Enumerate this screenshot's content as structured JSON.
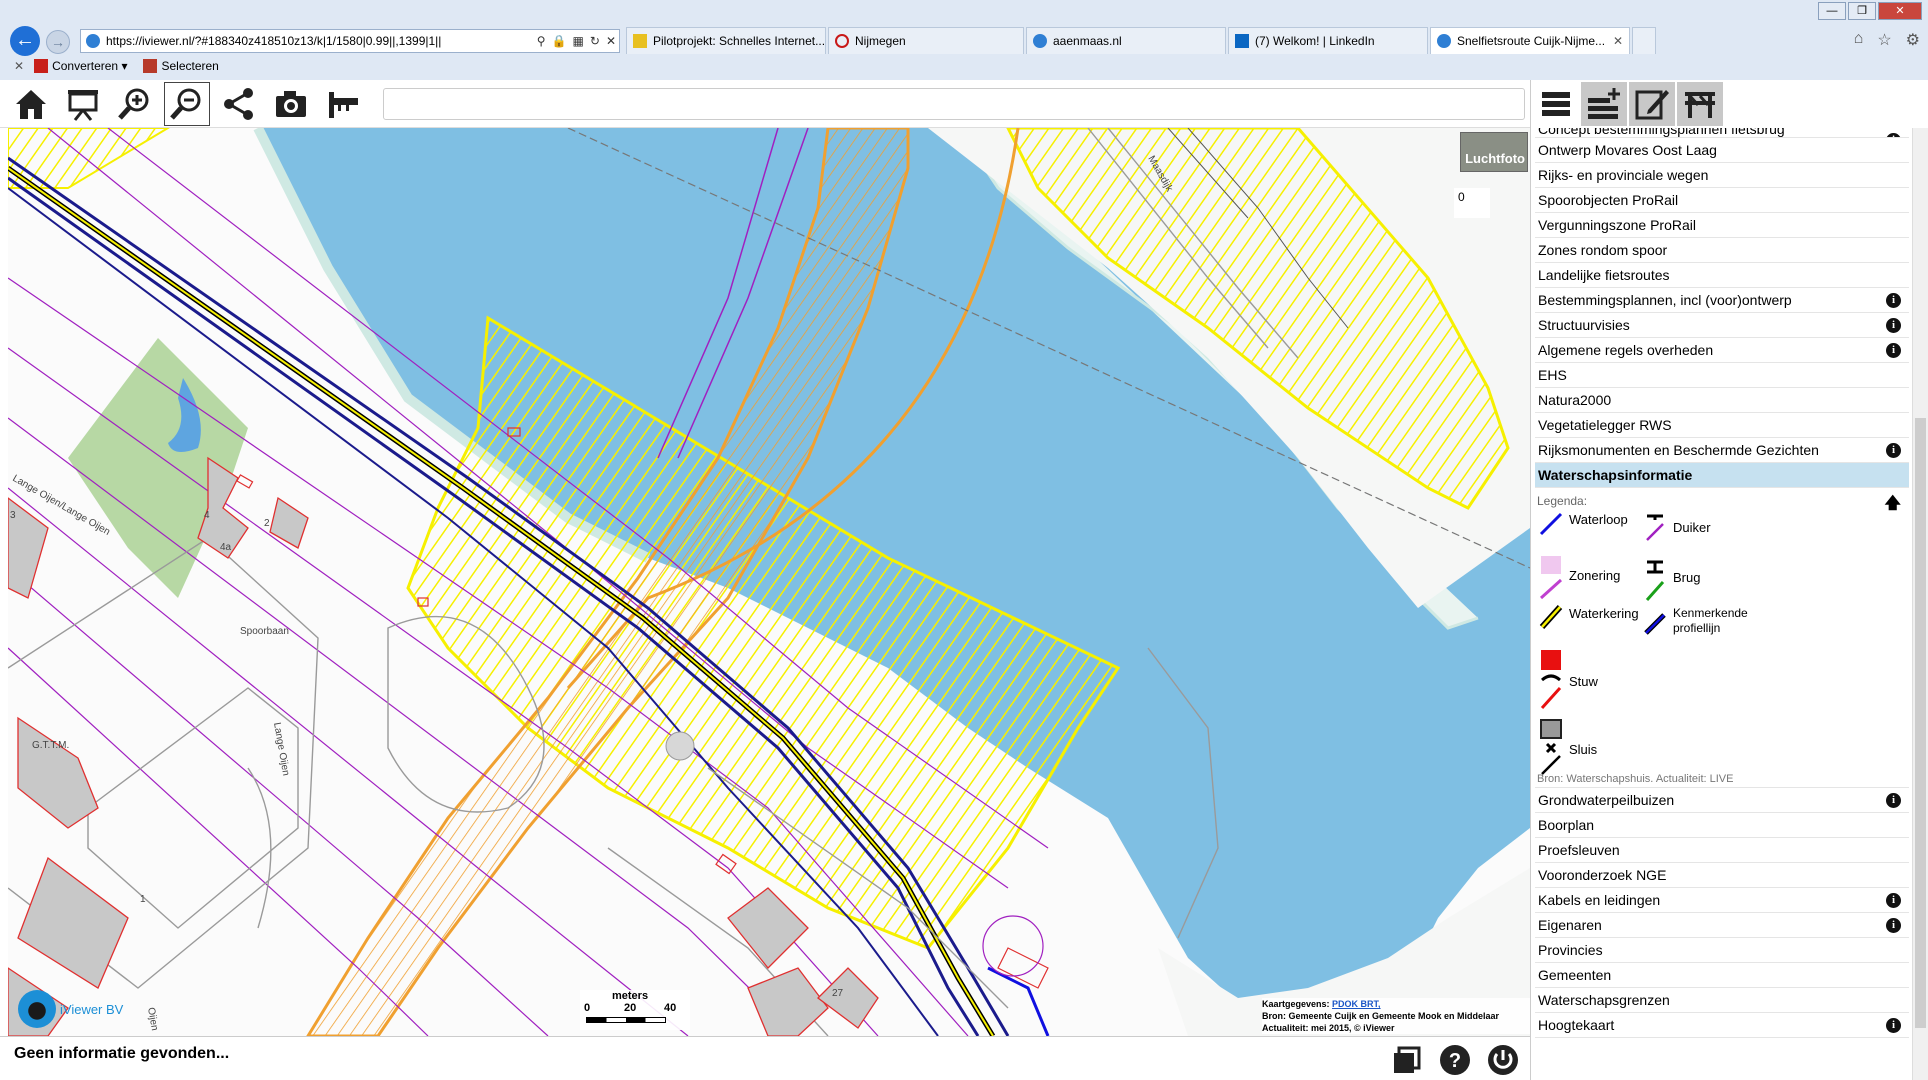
{
  "browser": {
    "url": "https://iviewer.nl/?#188340z418510z13/k|1/1580|0.99||,1399|1||",
    "tabs": [
      {
        "label": "Pilotprojekt: Schnelles Internet...",
        "active": false
      },
      {
        "label": "Nijmegen",
        "active": false
      },
      {
        "label": "aaenmaas.nl",
        "active": false
      },
      {
        "label": "(7) Welkom! | LinkedIn",
        "active": false
      },
      {
        "label": "Snelfietsroute Cuijk-Nijme...",
        "active": true
      }
    ],
    "commands": {
      "convert": "Converteren",
      "select": "Selecteren"
    }
  },
  "toolbar": {
    "icons": [
      "home-icon",
      "presentation-icon",
      "zoom-in-icon",
      "zoom-out-icon",
      "share-icon",
      "camera-icon",
      "measure-icon"
    ],
    "search_value": ""
  },
  "map": {
    "luchtfoto_label": "Luchtfoto",
    "luchtfoto_value": "0",
    "labels": {
      "spoorbaan": "Spoorbaan",
      "lange_oijen": "Lange Oijen",
      "lange_oijen_road": "Lange Oijen/Lange Oijen",
      "gttm": "G.T.T.M.",
      "oijen": "Oijen",
      "maasdijk": "Maasdijk",
      "n3": "3",
      "n4": "4",
      "n4a": "4a",
      "n2": "2",
      "n1": "1",
      "n27": "27"
    },
    "scale": {
      "unit": "meters",
      "ticks": [
        "0",
        "20",
        "40"
      ]
    },
    "attribution": {
      "prefix": "Kaartgegevens:",
      "link": "PDOK BRT,",
      "source": "Bron: Gemeente Cuijk en Gemeente Mook en Middelaar",
      "date": "Actualiteit: mei 2015, © iViewer"
    },
    "logo_text": "iViewer BV"
  },
  "status": {
    "message": "Geen informatie gevonden..."
  },
  "panel": {
    "layers_top": [
      {
        "label": "Concept bestemmingsplannen fietsbrug",
        "info": true,
        "clipped": true
      },
      {
        "label": "Ontwerp Movares Oost Laag",
        "info": false
      },
      {
        "label": "Rijks- en provinciale wegen",
        "info": false
      },
      {
        "label": "Spoorobjecten ProRail",
        "info": false
      },
      {
        "label": "Vergunningszone ProRail",
        "info": false
      },
      {
        "label": "Zones rondom spoor",
        "info": false
      },
      {
        "label": "Landelijke fietsroutes",
        "info": false
      },
      {
        "label": "Bestemmingsplannen, incl (voor)ontwerp",
        "info": true
      },
      {
        "label": "Structuurvisies",
        "info": true
      },
      {
        "label": "Algemene regels overheden",
        "info": true
      },
      {
        "label": "EHS",
        "info": false
      },
      {
        "label": "Natura2000",
        "info": false
      },
      {
        "label": "Vegetatielegger RWS",
        "info": false
      },
      {
        "label": "Rijksmonumenten en Beschermde Gezichten",
        "info": true
      }
    ],
    "open_layer": "Waterschapsinformatie",
    "legend": {
      "title": "Legenda:",
      "items": {
        "waterloop": "Waterloop",
        "duiker": "Duiker",
        "zonering": "Zonering",
        "brug": "Brug",
        "waterkering": "Waterkering",
        "kenmerkende": "Kenmerkende profiellijn",
        "stuw": "Stuw",
        "sluis": "Sluis"
      },
      "source": "Bron: Waterschapshuis. Actualiteit: LIVE"
    },
    "layers_bottom": [
      {
        "label": "Grondwaterpeilbuizen",
        "info": true
      },
      {
        "label": "Boorplan",
        "info": false
      },
      {
        "label": "Proefsleuven",
        "info": false
      },
      {
        "label": "Vooronderzoek NGE",
        "info": false
      },
      {
        "label": "Kabels en leidingen",
        "info": true
      },
      {
        "label": "Eigenaren",
        "info": true
      },
      {
        "label": "Provincies",
        "info": false
      },
      {
        "label": "Gemeenten",
        "info": false
      },
      {
        "label": "Waterschapsgrenzen",
        "info": false
      },
      {
        "label": "Hoogtekaart",
        "info": true
      }
    ],
    "info_glyph": "i",
    "up_glyph": "🡅"
  },
  "colors": {
    "water": "#7fbfe3",
    "hatch": "#f6f000",
    "orange": "#f0a030",
    "purple": "#a020c0",
    "navy": "#1b1b8c",
    "highlight": "#c6e1f0"
  }
}
